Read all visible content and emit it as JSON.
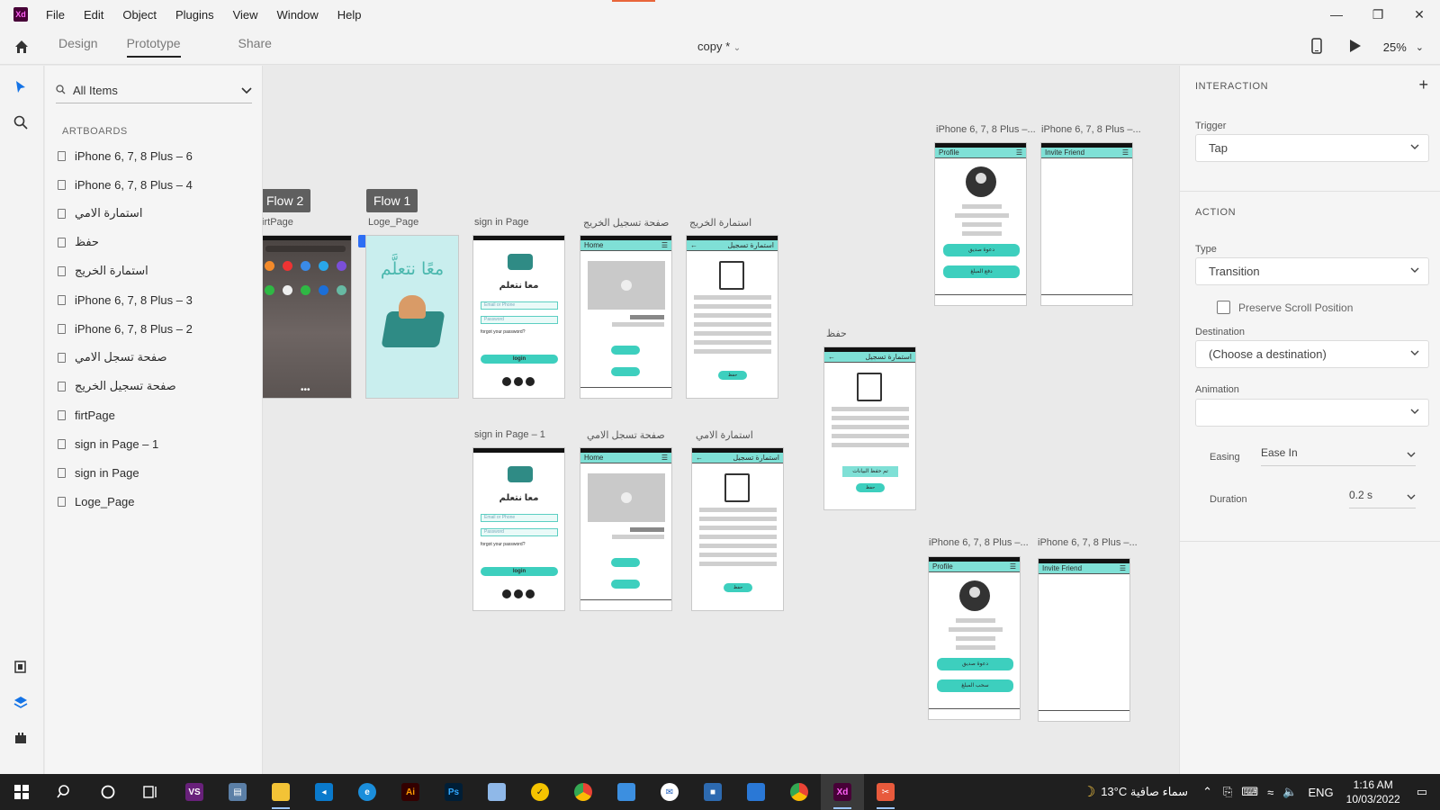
{
  "menu": [
    "File",
    "Edit",
    "Object",
    "Plugins",
    "View",
    "Window",
    "Help"
  ],
  "toolbar": {
    "modes": [
      "Design",
      "Prototype",
      "Share"
    ],
    "active_mode": "Prototype",
    "doc_title": "copy *",
    "zoom": "25%"
  },
  "layers": {
    "search_placeholder": "All Items",
    "section": "ARTBOARDS",
    "items": [
      "iPhone 6, 7, 8 Plus – 6",
      "iPhone 6, 7, 8 Plus – 4",
      "استمارة الامي",
      "حفظ",
      "استمارة الخريج",
      "iPhone 6, 7, 8 Plus – 3",
      "iPhone 6, 7, 8 Plus – 2",
      "صفحة تسجل الامي",
      "صفحة تسجيل الخريج",
      "firtPage",
      "sign in Page – 1",
      "sign in Page",
      "Loge_Page"
    ]
  },
  "canvas": {
    "flows": [
      "Flow 2",
      "Flow 1"
    ],
    "labels": {
      "firtPage": "firtPage",
      "loge": "Loge_Page",
      "signin": "sign in Page",
      "grad_reg": "صفحة تسجيل الخريج",
      "grad_form": "استمارة الخريج",
      "signin1": "sign in Page – 1",
      "illit_reg": "صفحة تسجل الامي",
      "illit_form": "استمارة الامي",
      "save": "حفظ",
      "ip_a": "iPhone 6, 7, 8 Plus –...",
      "ip_b": "iPhone 6, 7, 8 Plus –...",
      "ip_c": "iPhone 6, 7, 8 Plus –...",
      "ip_d": "iPhone 6, 7, 8 Plus –..."
    },
    "mock": {
      "app_name": "معا نتعلم",
      "logo_text": "معًا نتعلَّم",
      "email": "Email or Phone",
      "password": "Password",
      "forgot": "forgot your password?",
      "login": "login",
      "home": "Home",
      "form_title": "استمارة تسجيل",
      "save_btn": "حفظ",
      "saved_msg": "تم حفظ البيانات",
      "profile": "Profile",
      "invite": "Invite Friend",
      "invite_btn": "دعوة صديق",
      "pay_btn": "دفع المبلغ",
      "withdraw_btn": "سحب المبلغ"
    }
  },
  "props": {
    "interaction": "INTERACTION",
    "trigger_label": "Trigger",
    "trigger": "Tap",
    "action": "ACTION",
    "type_label": "Type",
    "type": "Transition",
    "preserve": "Preserve Scroll Position",
    "destination_label": "Destination",
    "destination": "(Choose a destination)",
    "animation_label": "Animation",
    "animation": "",
    "easing_label": "Easing",
    "easing": "Ease In",
    "duration_label": "Duration",
    "duration": "0.2 s"
  },
  "taskbar": {
    "weather": "13°C  سماء صافية",
    "lang": "ENG",
    "time": "1:16 AM",
    "date": "10/03/2022"
  },
  "colors": {
    "accent": "#470137",
    "teal": "#3dcfbe",
    "taskbar": "#1f1f1f"
  }
}
